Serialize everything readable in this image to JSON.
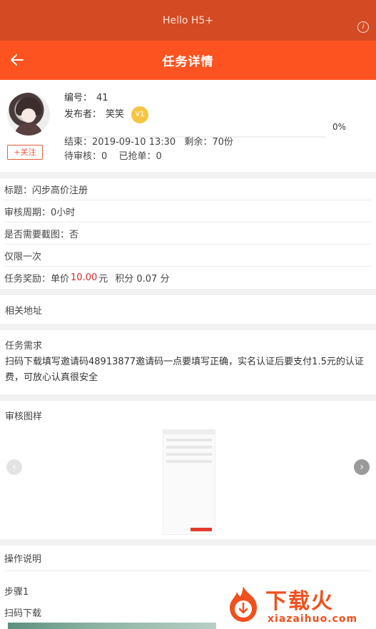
{
  "statusbar": {
    "title": "Hello H5+",
    "info_icon": "info-icon"
  },
  "navbar": {
    "title": "任务详情",
    "back_icon": "arrow-left-icon"
  },
  "publisher": {
    "id_label": "编号：",
    "id_value": "41",
    "publisher_label": "发布者：",
    "publisher_name": "笑笑",
    "vip_badge": "V1",
    "follow_label": "+关注",
    "progress_percent": 0,
    "progress_text": "0%",
    "end_label": "结束：",
    "end_value": "2019-09-10 13:30",
    "remaining_label": "剩余：",
    "remaining_value": "70份",
    "pending_label": "待审核：",
    "pending_value": "0",
    "grabbed_label": "已抢单：",
    "grabbed_value": "0"
  },
  "details": {
    "title_line": "标题：闪步高价注册",
    "review_period": "审核周期：0小时",
    "need_screenshot": "是否需要截图：否",
    "limit_once": "仅限一次",
    "reward_prefix": "任务奖励：单价",
    "reward_price": "10.00",
    "reward_unit": "元",
    "reward_points": "积分 0.07 分"
  },
  "address": {
    "label": "相关地址"
  },
  "requirement": {
    "label": "任务需求",
    "text": "扫码下载填写邀请码48913877邀请码一点要填写正确，实名认证后要支付1.5元的认证费，可放心认真很安全"
  },
  "gallery": {
    "label": "审核图样",
    "prev_icon": "chevron-left-icon",
    "next_icon": "chevron-right-icon"
  },
  "ops": {
    "label": "操作说明",
    "step1": "步骤1",
    "step1_text": "扫码下载"
  },
  "watermark": {
    "cn": "下载火",
    "en": "xiazaihuo.com"
  },
  "colors": {
    "brand": "#fd5320",
    "statusbar": "#d44a22",
    "price": "#d42a2a"
  }
}
